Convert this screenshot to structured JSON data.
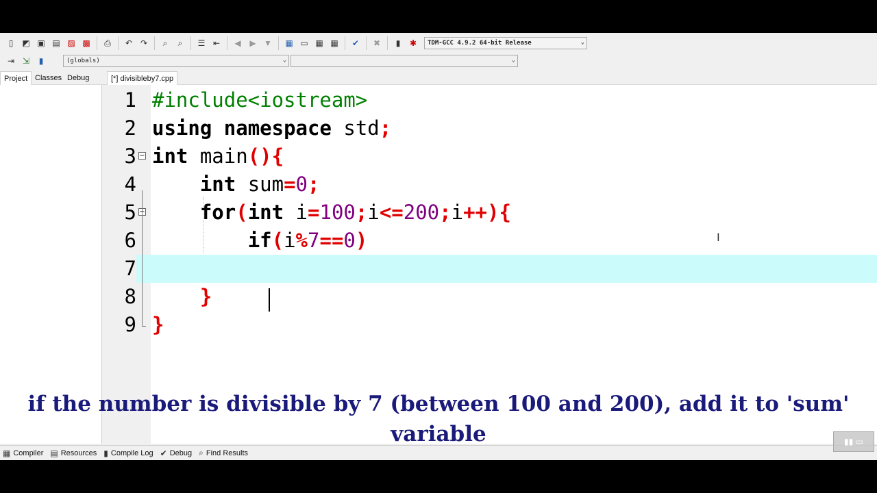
{
  "toolbar": {
    "compiler_select": "TDM-GCC 4.9.2 64-bit Release",
    "icons": [
      "new-file-icon",
      "open-icon",
      "save-icon",
      "save-all-icon",
      "close-icon",
      "close-all-icon",
      "print-icon",
      "undo-icon",
      "redo-icon",
      "find-icon",
      "replace-icon",
      "indent-icon",
      "unindent-icon",
      "bookmark-prev-icon",
      "bookmark-next-icon",
      "bookmark-icon",
      "new-project-icon",
      "window-icon",
      "compile-icon",
      "run-icon",
      "check-icon",
      "stop-icon",
      "chart-icon",
      "debug-icon"
    ]
  },
  "toolbar2": {
    "scope_select": "(globals)",
    "member_select": ""
  },
  "left_tabs": [
    "Project",
    "Classes",
    "Debug"
  ],
  "file_tab": "[*] divisibleby7.cpp",
  "editor": {
    "line_numbers": [
      "1",
      "2",
      "3",
      "4",
      "5",
      "6",
      "7",
      "8",
      "9"
    ],
    "lines": {
      "l1": "#include<iostream>",
      "l2_kw1": "using",
      "l2_kw2": "namespace",
      "l2_rest": " std",
      "l2_semi": ";",
      "l3_kw": "int",
      "l3_name": " main",
      "l3_open": "(){",
      "l4_kw": "int",
      "l4_name": " sum",
      "l4_eq": "=",
      "l4_num": "0",
      "l4_semi": ";",
      "l5_for": "for",
      "l5_paren": "(",
      "l5_int": "int",
      "l5_i": " i",
      "l5_eq": "=",
      "l5_100": "100",
      "l5_s1": ";",
      "l5_i2": "i",
      "l5_le": "<=",
      "l5_200": "200",
      "l5_s2": ";",
      "l5_i3": "i",
      "l5_pp": "++",
      "l5_close": "){",
      "l6_if": "if",
      "l6_paren": "(",
      "l6_i": "i",
      "l6_mod": "%",
      "l6_7": "7",
      "l6_eqeq": "==",
      "l6_0": "0",
      "l6_close": ")",
      "l8_brace": "}",
      "l9_brace": "}"
    }
  },
  "caption": {
    "line1": "if the number is divisible by 7 (between 100 and 200), add it to 'sum'",
    "line2": "variable"
  },
  "bottom_tabs": [
    {
      "label": "Compiler",
      "icon": "compiler-grid-icon"
    },
    {
      "label": "Resources",
      "icon": "resources-icon"
    },
    {
      "label": "Compile Log",
      "icon": "compile-log-icon"
    },
    {
      "label": "Debug",
      "icon": "debug-check-icon"
    },
    {
      "label": "Find Results",
      "icon": "find-results-icon"
    }
  ]
}
